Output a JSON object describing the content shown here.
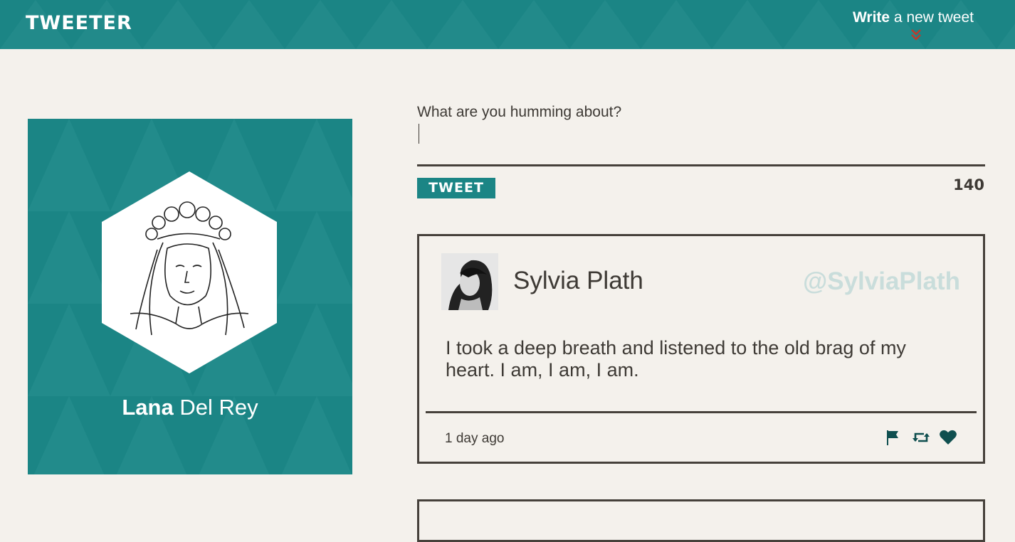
{
  "header": {
    "logo": "TWEETER",
    "compose_link_bold": "Write",
    "compose_link_rest": " a new tweet",
    "compose_chevron_icon": "double-chevron-down-icon"
  },
  "profile": {
    "first_name": "Lana",
    "last_name": " Del Rey",
    "avatar_icon": "hexagon-portrait"
  },
  "compose": {
    "prompt": "What are you humming about?",
    "value": "",
    "button_label": "TWEET",
    "char_count": "140"
  },
  "tweets": [
    {
      "author": "Sylvia Plath",
      "handle": "@SylviaPlath",
      "text": "I took a deep breath and listened to the old brag of my heart. I am, I am, I am.",
      "time": "1 day ago",
      "actions": [
        "flag-icon",
        "retweet-icon",
        "heart-icon"
      ]
    }
  ],
  "colors": {
    "teal": "#1b8585",
    "background": "#f4f1ec",
    "text": "#3e3a35",
    "handle": "#c9dddb",
    "chevron": "#c0392b"
  }
}
